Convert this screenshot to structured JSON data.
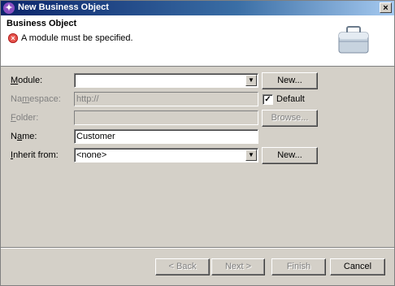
{
  "window": {
    "title": "New Business Object",
    "close_glyph": "×"
  },
  "banner": {
    "title": "Business Object",
    "message": "A module must be specified.",
    "error_icon": "error-icon",
    "illustration_icon": "briefcase-icon"
  },
  "form": {
    "module": {
      "label_u": "M",
      "label_rest": "odule:",
      "value": "",
      "button": "New..."
    },
    "namespace": {
      "label_pre": "Na",
      "label_u": "m",
      "label_rest": "espace:",
      "value": "http://",
      "default_label": "Default",
      "default_checked": true
    },
    "folder": {
      "label_u": "F",
      "label_rest": "older:",
      "value": "",
      "button": "Browse..."
    },
    "name": {
      "label_pre": "N",
      "label_u": "a",
      "label_rest": "me:",
      "value": "Customer"
    },
    "inherit": {
      "label_u": "I",
      "label_rest": "nherit from:",
      "value": "<none>",
      "button": "New..."
    }
  },
  "footer": {
    "back": "< Back",
    "next": "Next >",
    "finish": "Finish",
    "cancel": "Cancel"
  },
  "colors": {
    "titlebar_start": "#0a246a",
    "dialog_bg": "#d4d0c8",
    "error": "#e8554e"
  }
}
